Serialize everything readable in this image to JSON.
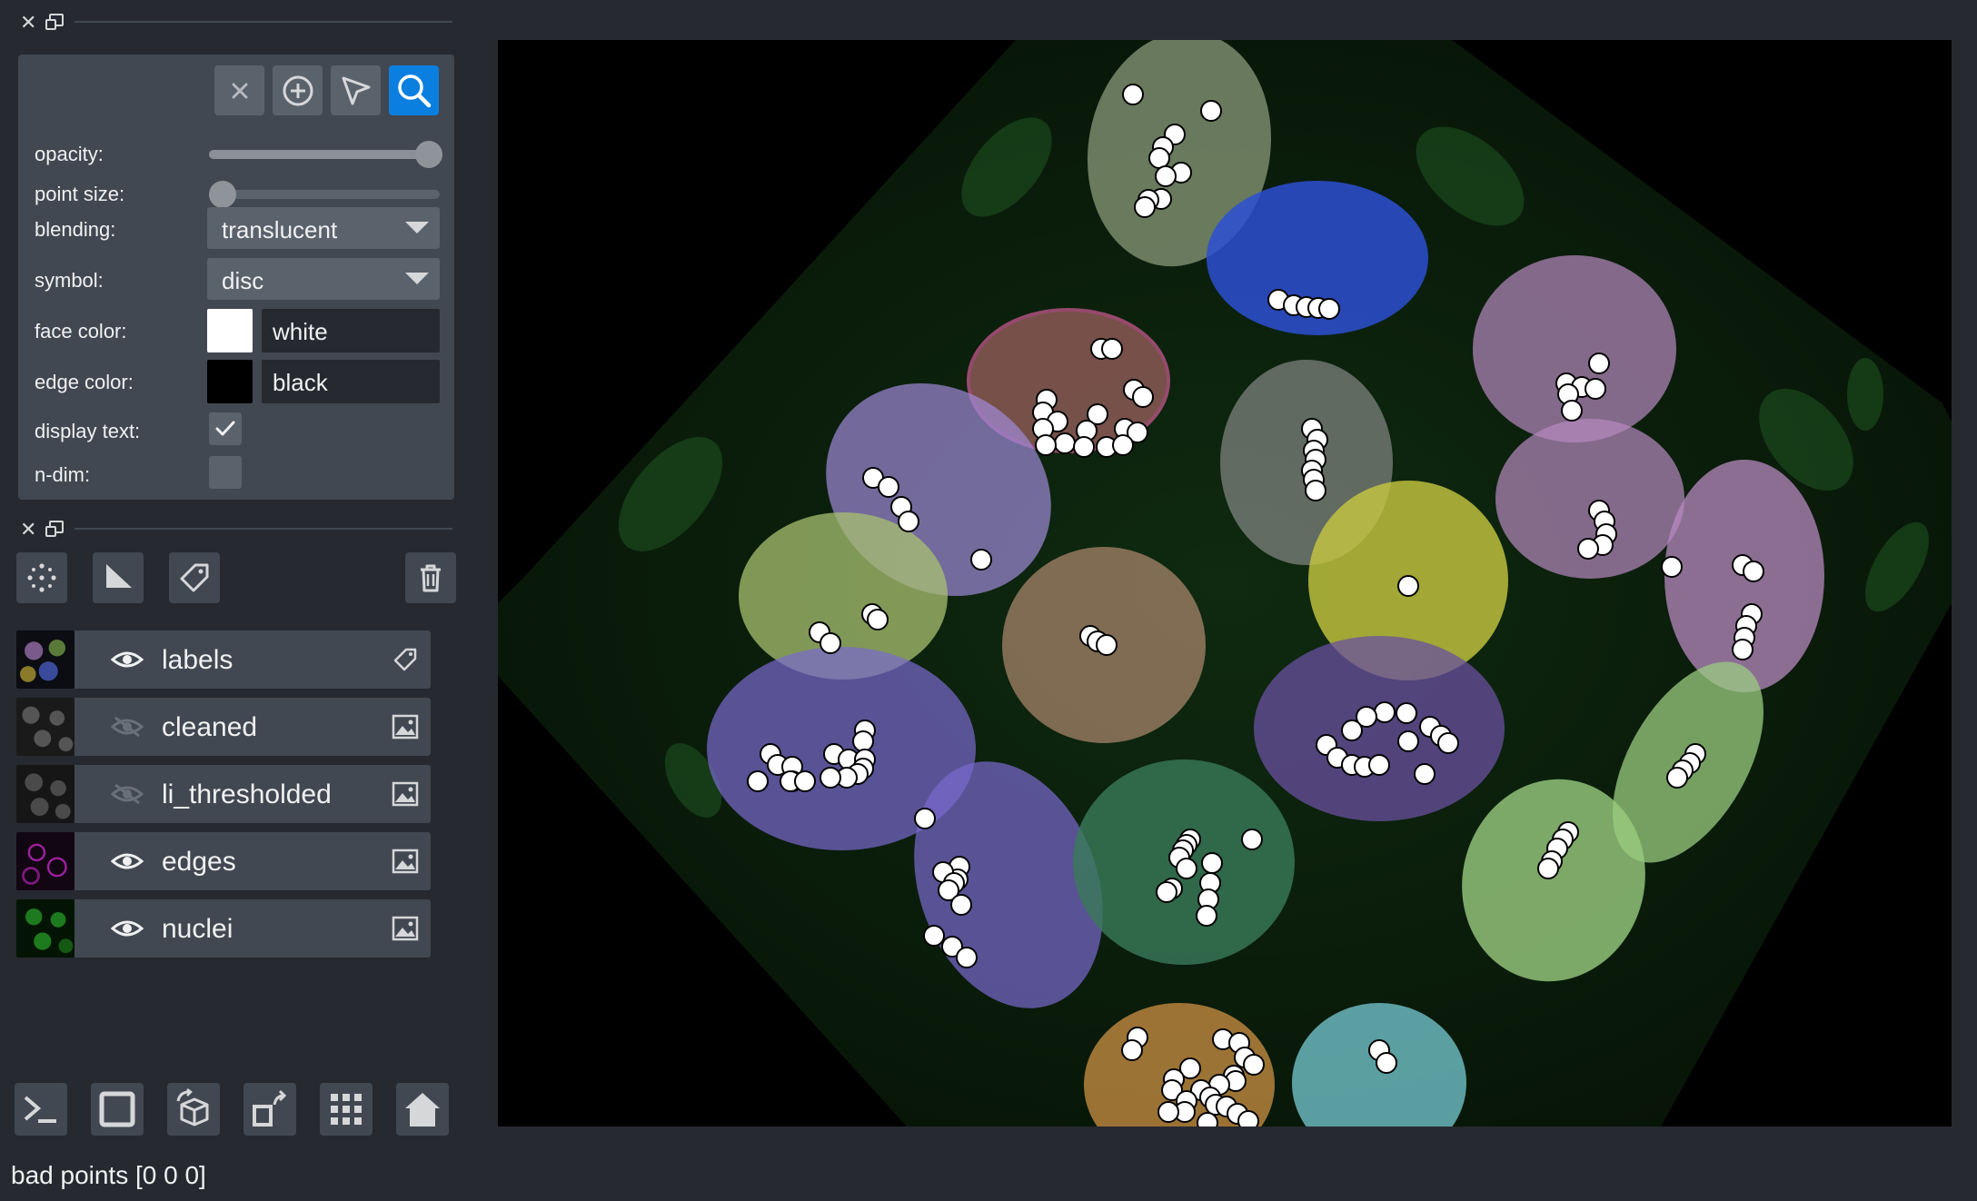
{
  "layer_controls": {
    "opacity_label": "opacity:",
    "opacity_value": 1.0,
    "point_size_label": "point size:",
    "point_size_value": 0.0,
    "blending_label": "blending:",
    "blending_value": "translucent",
    "symbol_label": "symbol:",
    "symbol_value": "disc",
    "face_color_label": "face color:",
    "face_color_value": "white",
    "face_color_hex": "#ffffff",
    "edge_color_label": "edge color:",
    "edge_color_value": "black",
    "edge_color_hex": "#000000",
    "display_text_label": "display text:",
    "display_text_checked": true,
    "ndim_label": "n-dim:",
    "ndim_checked": false
  },
  "layers": [
    {
      "name": "labels",
      "visible": true,
      "type": "labels"
    },
    {
      "name": "cleaned",
      "visible": false,
      "type": "image"
    },
    {
      "name": "li_thresholded",
      "visible": false,
      "type": "image"
    },
    {
      "name": "edges",
      "visible": true,
      "type": "image"
    },
    {
      "name": "nuclei",
      "visible": true,
      "type": "image"
    }
  ],
  "icons": {
    "mode_buttons": [
      "delete-points-icon",
      "add-points-icon",
      "select-points-icon",
      "pan-zoom-icon"
    ],
    "layer_tools": [
      "new-points-layer-icon",
      "new-shapes-layer-icon",
      "new-labels-layer-icon",
      "delete-layer-icon"
    ],
    "viewer_buttons": [
      "console-icon",
      "ndisplay-icon",
      "roll-dims-icon",
      "transpose-icon",
      "grid-icon",
      "home-icon"
    ]
  },
  "colors": {
    "accent": "#0b7fe0",
    "background": "#262930",
    "panel": "#414851"
  },
  "status": {
    "text": "bad points [0 0 0]"
  }
}
